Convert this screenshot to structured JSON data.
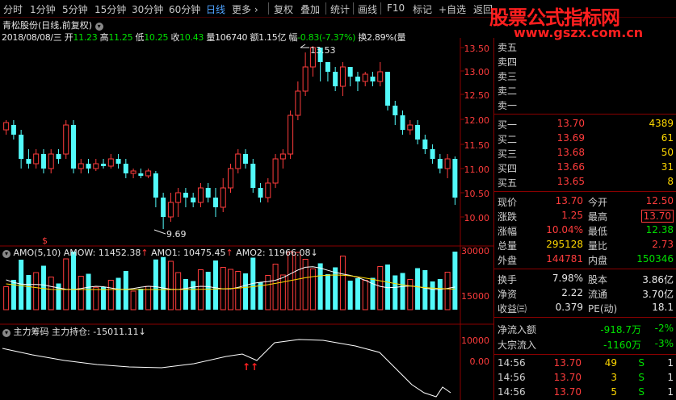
{
  "toolbar": {
    "tabs": [
      "分时",
      "1分钟",
      "5分钟",
      "15分钟",
      "30分钟",
      "60分钟",
      "日线",
      "更多"
    ],
    "active": "日线",
    "buttons": [
      "复权",
      "叠加",
      "统计",
      "画线",
      "F10",
      "标记",
      "+自选",
      "返回"
    ]
  },
  "watermark": {
    "title": "股票公式指标网",
    "url": "www.gszx.com.cn"
  },
  "chart_header": {
    "stock_name": "青松股份(日线,前复权)",
    "date": "2018/08/08/三",
    "open_label": "开",
    "open": "11.23",
    "high_label": "高",
    "high": "11.25",
    "low_label": "低",
    "low": "10.25",
    "close_label": "收",
    "close": "10.43",
    "volume_label": "量",
    "volume": "106740",
    "amount_label": "额",
    "amount": "1.15亿",
    "change_label": "幅",
    "change": "-0.83(-7.37%)",
    "turnover_label": "换",
    "turnover": "2.89%",
    "turnover_suffix": "(量"
  },
  "price_annotations": {
    "high_marker": "13.53",
    "low_marker": "9.69"
  },
  "amo_header": {
    "name": "AMO(5,10)",
    "amow": "AMOW: 11452.38",
    "amo1": "AMO1: 10475.45",
    "amo2": "AMO2: 11966.08"
  },
  "zhuli_header": {
    "name": "主力筹码",
    "value": "主力持仓: -15011.11"
  },
  "axes": {
    "price_ticks": [
      "13.50",
      "13.00",
      "12.50",
      "12.00",
      "11.50",
      "11.00",
      "10.50",
      "10.00"
    ],
    "amo_ticks": [
      "30000",
      "15000"
    ],
    "zhuli_ticks": [
      "10000",
      "0.00"
    ]
  },
  "panel": {
    "asks": [
      {
        "label": "卖五",
        "price": "",
        "vol": ""
      },
      {
        "label": "卖四",
        "price": "",
        "vol": ""
      },
      {
        "label": "卖三",
        "price": "",
        "vol": ""
      },
      {
        "label": "卖二",
        "price": "",
        "vol": ""
      },
      {
        "label": "卖一",
        "price": "",
        "vol": ""
      }
    ],
    "bids": [
      {
        "label": "买一",
        "price": "13.70",
        "vol": "4389"
      },
      {
        "label": "买二",
        "price": "13.69",
        "vol": "61"
      },
      {
        "label": "买三",
        "price": "13.68",
        "vol": "50"
      },
      {
        "label": "买四",
        "price": "13.66",
        "vol": "31"
      },
      {
        "label": "买五",
        "price": "13.65",
        "vol": "8"
      }
    ],
    "stats": [
      {
        "l1": "现价",
        "v1": "13.70",
        "l2": "今开",
        "v2": "12.50"
      },
      {
        "l1": "涨跌",
        "v1": "1.25",
        "l2": "最高",
        "v2": "13.70"
      },
      {
        "l1": "涨幅",
        "v1": "10.04%",
        "l2": "最低",
        "v2": "12.38"
      },
      {
        "l1": "总量",
        "v1": "295128",
        "l2": "量比",
        "v2": "2.73"
      },
      {
        "l1": "外盘",
        "v1": "144781",
        "l2": "内盘",
        "v2": "150346"
      }
    ],
    "stats2": [
      {
        "l1": "换手",
        "v1": "7.98%",
        "l2": "股本",
        "v2": "3.86亿"
      },
      {
        "l1": "净资",
        "v1": "2.22",
        "l2": "流通",
        "v2": "3.70亿"
      },
      {
        "l1": "收益㈢",
        "v1": "0.379",
        "l2": "PE(动)",
        "v2": "18.1"
      }
    ],
    "flows": [
      {
        "label": "净流入额",
        "value": "-918.7万",
        "pct": "-2%"
      },
      {
        "label": "大宗流入",
        "value": "-1160万",
        "pct": "-3%"
      }
    ],
    "ticks": [
      {
        "time": "14:56",
        "price": "13.70",
        "vol": "49",
        "side": "S",
        "n": "1"
      },
      {
        "time": "14:56",
        "price": "13.70",
        "vol": "3",
        "side": "S",
        "n": "1"
      },
      {
        "time": "14:56",
        "price": "13.70",
        "vol": "5",
        "side": "S",
        "n": "1"
      }
    ]
  },
  "colors": {
    "up": "#ff3c3c",
    "down": "#52fafa",
    "ma": "#ffffff",
    "ma2": "#ffd800",
    "frame": "#8a0000"
  }
}
